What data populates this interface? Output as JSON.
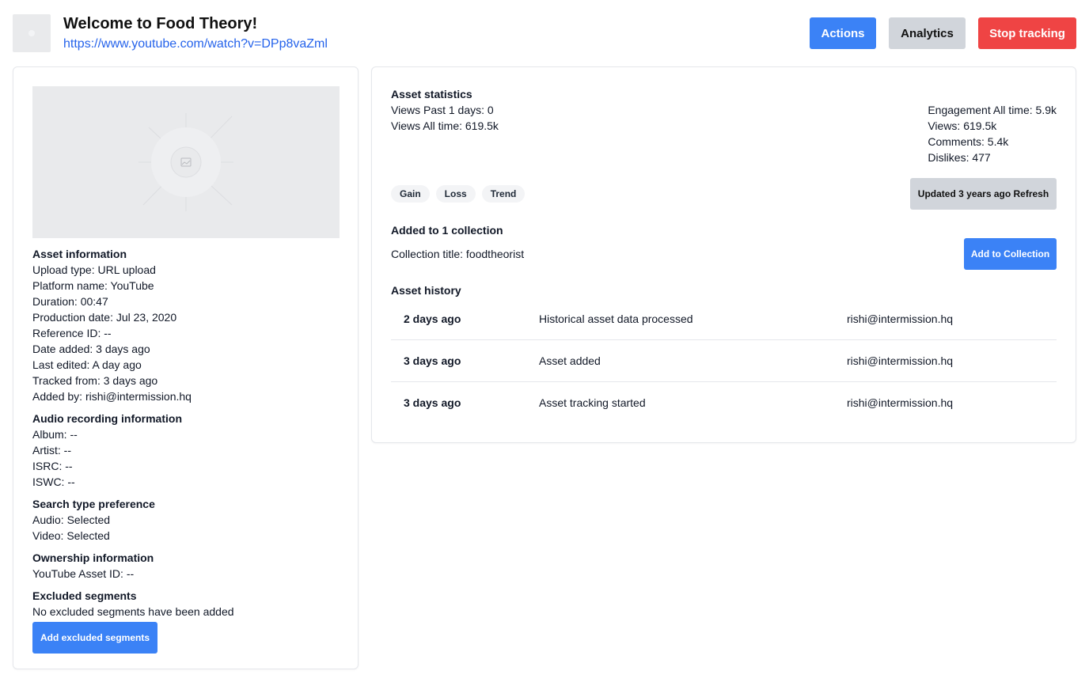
{
  "header": {
    "title": "Welcome to Food Theory!",
    "url": "https://www.youtube.com/watch?v=DPp8vaZml",
    "buttons": {
      "actions": "Actions",
      "analytics": "Analytics",
      "stop": "Stop tracking"
    }
  },
  "asset_info": {
    "heading": "Asset information",
    "upload_type": "Upload type: URL upload",
    "platform": "Platform name: YouTube",
    "duration": "Duration: 00:47",
    "production_date": "Production date: Jul 23, 2020",
    "reference_id": "Reference ID: --",
    "date_added": "Date added: 3 days ago",
    "last_edited": "Last edited: A day ago",
    "tracked_from": "Tracked from: 3 days ago",
    "added_by": "Added by: rishi@intermission.hq"
  },
  "audio_info": {
    "heading": "Audio recording information",
    "album": "Album: --",
    "artist": "Artist: --",
    "isrc": "ISRC: --",
    "iswc": "ISWC: --"
  },
  "search_pref": {
    "heading": "Search type preference",
    "audio": "Audio: Selected",
    "video": "Video: Selected"
  },
  "ownership": {
    "heading": "Ownership information",
    "youtube_asset_id": "YouTube Asset ID: --"
  },
  "excluded": {
    "heading": "Excluded segments",
    "empty_text": "No excluded segments have been added",
    "button": "Add excluded segments"
  },
  "stats": {
    "heading": "Asset statistics",
    "views_past": "Views Past 1 days: 0",
    "views_all": "Views All time: 619.5k",
    "engagement": "Engagement All time: 5.9k",
    "views": "Views: 619.5k",
    "comments": "Comments: 5.4k",
    "dislikes": "Dislikes: 477",
    "chips": [
      "Gain",
      "Loss",
      "Trend"
    ],
    "refresh": "Updated 3 years ago Refresh"
  },
  "collection": {
    "heading": "Added to 1 collection",
    "title_text": "Collection title: foodtheorist",
    "button": "Add to Collection"
  },
  "history": {
    "heading": "Asset history",
    "rows": [
      {
        "when": "2 days ago",
        "what": "Historical asset data processed",
        "who": "rishi@intermission.hq"
      },
      {
        "when": "3 days ago",
        "what": "Asset added",
        "who": "rishi@intermission.hq"
      },
      {
        "when": "3 days ago",
        "what": "Asset tracking started",
        "who": "rishi@intermission.hq"
      }
    ]
  }
}
